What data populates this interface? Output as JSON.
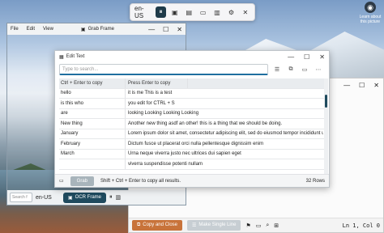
{
  "toolbar": {
    "language": "en-US"
  },
  "about": {
    "label": "Learn about this picture"
  },
  "grab_frame": {
    "menu": [
      "File",
      "Edit",
      "View"
    ],
    "title": "Grab Frame",
    "search_placeholder": "Search f",
    "language": "en-US",
    "ocr_button": "OCR Frame"
  },
  "edit_text": {
    "title": "Edit Text",
    "search_placeholder": "Type to search...",
    "columns": [
      "Ctrl + Enter to copy",
      "Press Enter to copy"
    ],
    "rows": [
      {
        "key": "hello",
        "value": "it is me This is a test"
      },
      {
        "key": "is this who",
        "value": "you edit for CTRL + S"
      },
      {
        "key": "are",
        "value": "looking Looking Looking Looking"
      },
      {
        "key": "New thing",
        "value": "Another new thing asdf an other! this is a thing that we should be doing."
      },
      {
        "key": "January",
        "value": "Lorem ipsum dolor sit amet, consectetur adipiscing elit, sed do eiusmod tempor incididunt u"
      },
      {
        "key": "February",
        "value": "Dictum fusce ut placerat orci nulla pellentesque dignissim enim"
      },
      {
        "key": "March",
        "value": "Urna neque viverra justo nec ultrices dui sapien eget"
      },
      {
        "key": "",
        "value": "viverra suspendisse potenti nullam"
      }
    ],
    "grab_button": "Grab",
    "hint": "Shift + Ctrl + Enter to copy all results.",
    "row_count": "32 Rows"
  },
  "editor": {
    "copy_close": "Copy and Close",
    "single_line": "Make Single Line",
    "position": "Ln 1, Col 0"
  }
}
